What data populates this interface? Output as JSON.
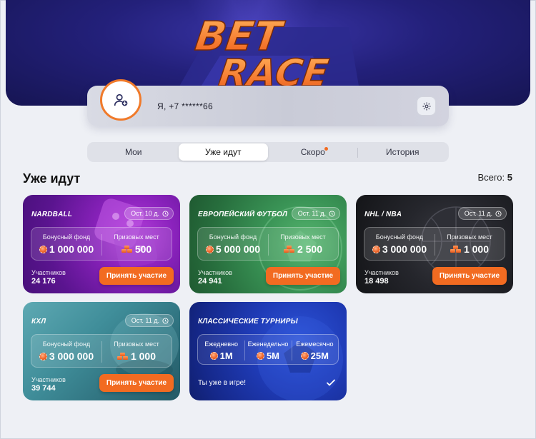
{
  "header": {
    "logo_line1": "BET",
    "logo_line2": "RACE"
  },
  "profile": {
    "phone": "Я, +7 ******66"
  },
  "tabs": [
    {
      "label": "Мои"
    },
    {
      "label": "Уже идут"
    },
    {
      "label": "Скоро"
    },
    {
      "label": "История"
    }
  ],
  "section": {
    "title": "Уже идут",
    "total_label": "Всего:",
    "total_value": "5"
  },
  "cards": [
    {
      "name": "NARDBALL",
      "date": "Ост. 10 д.",
      "fund_label": "Бонусный фонд",
      "fund_value": "1 000 000",
      "places_label": "Призовых мест",
      "places_value": "500",
      "members_label": "Участников",
      "members_value": "24 176",
      "join_label": "Принять участие"
    },
    {
      "name": "ЕВРОПЕЙСКИЙ ФУТБОЛ",
      "date": "Ост. 11 д.",
      "fund_label": "Бонусный фонд",
      "fund_value": "5 000 000",
      "places_label": "Призовых мест",
      "places_value": "2 500",
      "members_label": "Участников",
      "members_value": "24 941",
      "join_label": "Принять участие"
    },
    {
      "name": "NHL / NBA",
      "date": "Ост. 11 д.",
      "fund_label": "Бонусный фонд",
      "fund_value": "3 000 000",
      "places_label": "Призовых мест",
      "places_value": "1 000",
      "members_label": "Участников",
      "members_value": "18 498",
      "join_label": "Принять участие"
    },
    {
      "name": "КХЛ",
      "date": "Ост. 11 д.",
      "fund_label": "Бонусный фонд",
      "fund_value": "3 000 000",
      "places_label": "Призовых мест",
      "places_value": "1 000",
      "members_label": "Участников",
      "members_value": "39 744",
      "join_label": "Принять участие"
    }
  ],
  "classic": {
    "name": "КЛАССИЧЕСКИЕ ТУРНИРЫ",
    "tiers": [
      {
        "label": "Ежедневно",
        "value": "1M"
      },
      {
        "label": "Еженедельно",
        "value": "5M"
      },
      {
        "label": "Ежемесячно",
        "value": "25M"
      }
    ],
    "status": "Ты уже в игре!"
  },
  "colors": {
    "accent": "#f26b21",
    "hero": "#23207a",
    "nardball": "#7a1fb0",
    "football": "#2f8a4f",
    "nhl": "#1b1c20",
    "khl": "#3e8e9a",
    "classic": "#1d3ab8"
  },
  "icons": [
    "add-user-icon",
    "gear-icon",
    "clock-icon",
    "chip-icon",
    "prize-stack-icon",
    "check-icon"
  ]
}
